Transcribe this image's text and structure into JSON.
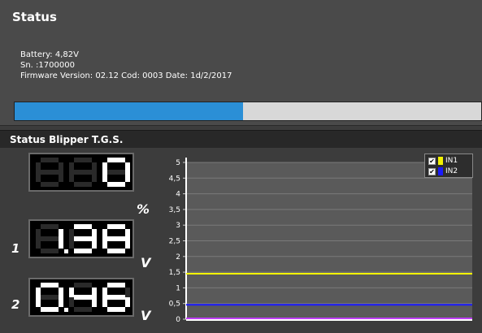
{
  "status": {
    "title": "Status",
    "battery": "Battery: 4,82V",
    "serial": "Sn. :1700000",
    "firmware": "Firmware Version: 02.12 Cod: 0003 Date: 1d/2/2017",
    "progress_fraction": 0.49
  },
  "blipper": {
    "title": "Status Blipper T.G.S.",
    "display_percent": {
      "value": "0",
      "unit": "%"
    },
    "display_ch1": {
      "channel": "1",
      "value": "1.38",
      "unit": "V"
    },
    "display_ch2": {
      "channel": "2",
      "value": "0.46",
      "unit": "V"
    }
  },
  "chart_data": {
    "type": "line",
    "ylim": [
      0,
      5
    ],
    "y_ticks": [
      "0",
      "0,5",
      "1",
      "1,5",
      "2",
      "2,5",
      "3",
      "3,5",
      "4",
      "4,5",
      "5"
    ],
    "series": [
      {
        "name": "IN1",
        "color": "#f2f200",
        "checked": true,
        "value": 1.45
      },
      {
        "name": "IN2",
        "color": "#1a1aff",
        "checked": true,
        "value": 0.46
      }
    ],
    "baseline_color": "#c040ff",
    "grid": true,
    "legend": "top-right"
  }
}
